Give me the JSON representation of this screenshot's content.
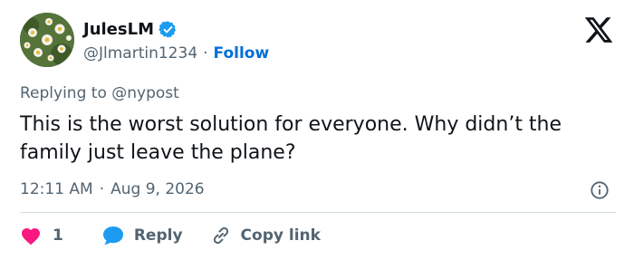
{
  "user": {
    "display_name": "JulesLM",
    "handle": "@Jlmartin1234",
    "separator": "·",
    "follow_label": "Follow"
  },
  "tweet": {
    "reply_prefix": "Replying to",
    "reply_to": "@nypost",
    "text": "This is the worst solution for everyone. Why didn’t the family just leave the plane?",
    "time": "12:11 AM",
    "separator": "·",
    "date": "Aug 9, 2026"
  },
  "actions": {
    "like_count": "1",
    "reply_label": "Reply",
    "copy_label": "Copy link"
  },
  "colors": {
    "like": "#f91880",
    "reply": "#1d9bf0",
    "verified": "#1d9bf0",
    "link": "#006fd6",
    "muted": "#536471",
    "divider": "#cfd9de"
  },
  "icons": [
    "avatar",
    "verified-badge-icon",
    "x-logo-icon",
    "info-icon",
    "heart-icon",
    "reply-bubble-icon",
    "link-icon"
  ]
}
